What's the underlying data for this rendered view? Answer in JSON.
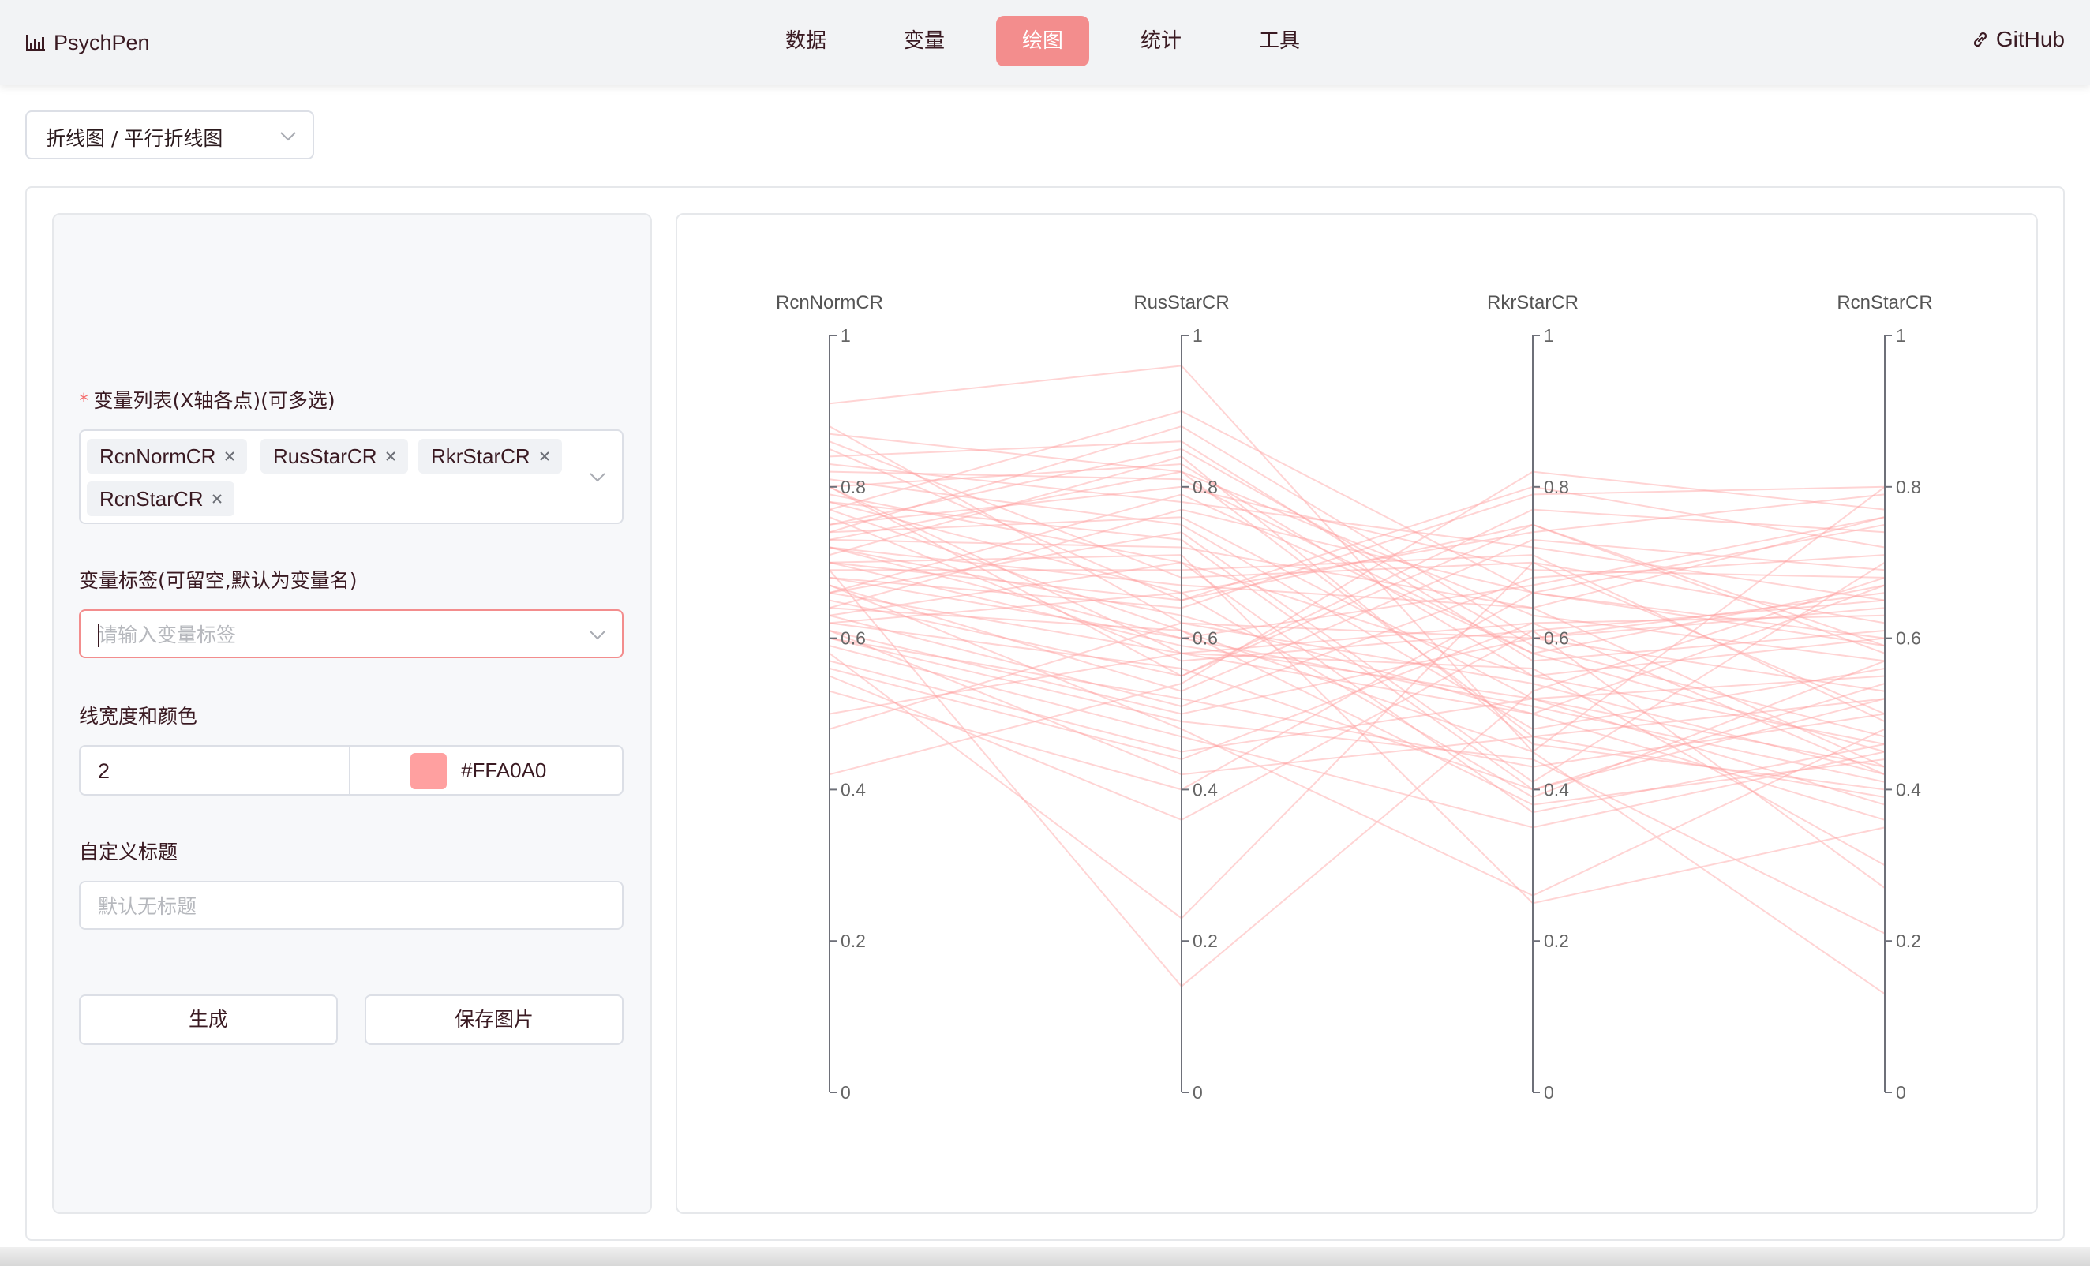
{
  "header": {
    "brand": "PsychPen",
    "nav_tabs": [
      "数据",
      "变量",
      "绘图",
      "统计",
      "工具"
    ],
    "active_tab": "绘图",
    "github": "GitHub"
  },
  "chart_type_select": {
    "value": "折线图 / 平行折线图"
  },
  "form": {
    "variables_label": "变量列表(X轴各点)(可多选)",
    "selected_variables": [
      "RcnNormCR",
      "RusStarCR",
      "RkrStarCR",
      "RcnStarCR"
    ],
    "labels_label": "变量标签(可留空,默认为变量名)",
    "labels_placeholder": "请输入变量标签",
    "width_color_label": "线宽度和颜色",
    "line_width": "2",
    "line_color": "#FFA0A0",
    "title_label": "自定义标题",
    "title_placeholder": "默认无标题",
    "generate_button": "生成",
    "save_button": "保存图片"
  },
  "colors": {
    "accent": "#f38d8d",
    "line": "#FFA0A0",
    "required_star": "#f56c6c"
  },
  "chart_data": {
    "type": "parallel-coordinates",
    "axes": [
      "RcnNormCR",
      "RusStarCR",
      "RkrStarCR",
      "RcnStarCR"
    ],
    "ylim": [
      0,
      1
    ],
    "ticks": [
      "0",
      "0.2",
      "0.4",
      "0.6",
      "0.8",
      "1"
    ],
    "line_color": "#FFA0A0",
    "line_width": 2,
    "series": [
      [
        0.8,
        0.55,
        0.75,
        0.58
      ],
      [
        0.72,
        0.63,
        0.5,
        0.67
      ],
      [
        0.91,
        0.96,
        0.45,
        0.8
      ],
      [
        0.66,
        0.58,
        0.62,
        0.42
      ],
      [
        0.75,
        0.85,
        0.59,
        0.47
      ],
      [
        0.6,
        0.49,
        0.44,
        0.21
      ],
      [
        0.7,
        0.65,
        0.8,
        0.72
      ],
      [
        0.63,
        0.7,
        0.55,
        0.6
      ],
      [
        0.82,
        0.81,
        0.58,
        0.45
      ],
      [
        0.55,
        0.36,
        0.61,
        0.65
      ],
      [
        0.78,
        0.73,
        0.4,
        0.52
      ],
      [
        0.68,
        0.6,
        0.67,
        0.76
      ],
      [
        0.86,
        0.68,
        0.7,
        0.62
      ],
      [
        0.61,
        0.42,
        0.47,
        0.39
      ],
      [
        0.74,
        0.76,
        0.52,
        0.55
      ],
      [
        0.69,
        0.14,
        0.53,
        0.68
      ],
      [
        0.58,
        0.23,
        0.7,
        0.5
      ],
      [
        0.64,
        0.61,
        0.38,
        0.44
      ],
      [
        0.77,
        0.9,
        0.66,
        0.59
      ],
      [
        0.42,
        0.54,
        0.82,
        0.77
      ],
      [
        0.72,
        0.67,
        0.64,
        0.43
      ],
      [
        0.67,
        0.48,
        0.26,
        0.48
      ],
      [
        0.83,
        0.78,
        0.72,
        0.65
      ],
      [
        0.5,
        0.58,
        0.56,
        0.3
      ],
      [
        0.71,
        0.84,
        0.46,
        0.4
      ],
      [
        0.62,
        0.66,
        0.74,
        0.79
      ],
      [
        0.8,
        0.58,
        0.5,
        0.36
      ],
      [
        0.73,
        0.82,
        0.63,
        0.57
      ],
      [
        0.66,
        0.74,
        0.41,
        0.7
      ],
      [
        0.53,
        0.4,
        0.66,
        0.6
      ],
      [
        0.88,
        0.62,
        0.6,
        0.53
      ],
      [
        0.79,
        0.7,
        0.37,
        0.46
      ],
      [
        0.65,
        0.55,
        0.77,
        0.74
      ],
      [
        0.57,
        0.45,
        0.52,
        0.43
      ],
      [
        0.75,
        0.8,
        0.69,
        0.68
      ],
      [
        0.7,
        0.71,
        0.25,
        0.35
      ],
      [
        0.84,
        0.86,
        0.57,
        0.61
      ],
      [
        0.6,
        0.52,
        0.43,
        0.5
      ],
      [
        0.68,
        0.64,
        0.79,
        0.8
      ],
      [
        0.76,
        0.57,
        0.61,
        0.27
      ],
      [
        0.48,
        0.62,
        0.54,
        0.42
      ],
      [
        0.81,
        0.75,
        0.48,
        0.56
      ],
      [
        0.63,
        0.51,
        0.68,
        0.71
      ],
      [
        0.74,
        0.88,
        0.6,
        0.64
      ],
      [
        0.59,
        0.47,
        0.35,
        0.45
      ],
      [
        0.69,
        0.69,
        0.71,
        0.49
      ],
      [
        0.77,
        0.61,
        0.45,
        0.13
      ],
      [
        0.66,
        0.79,
        0.58,
        0.67
      ],
      [
        0.85,
        0.65,
        0.75,
        0.59
      ],
      [
        0.62,
        0.56,
        0.4,
        0.54
      ],
      [
        0.73,
        0.72,
        0.64,
        0.76
      ],
      [
        0.7,
        0.59,
        0.52,
        0.38
      ],
      [
        0.56,
        0.44,
        0.62,
        0.63
      ],
      [
        0.8,
        0.83,
        0.55,
        0.46
      ],
      [
        0.67,
        0.53,
        0.73,
        0.69
      ],
      [
        0.78,
        0.66,
        0.39,
        0.57
      ],
      [
        0.64,
        0.77,
        0.66,
        0.75
      ],
      [
        0.72,
        0.6,
        0.51,
        0.41
      ],
      [
        0.87,
        0.82,
        0.47,
        0.52
      ],
      [
        0.61,
        0.5,
        0.6,
        0.66
      ]
    ]
  }
}
